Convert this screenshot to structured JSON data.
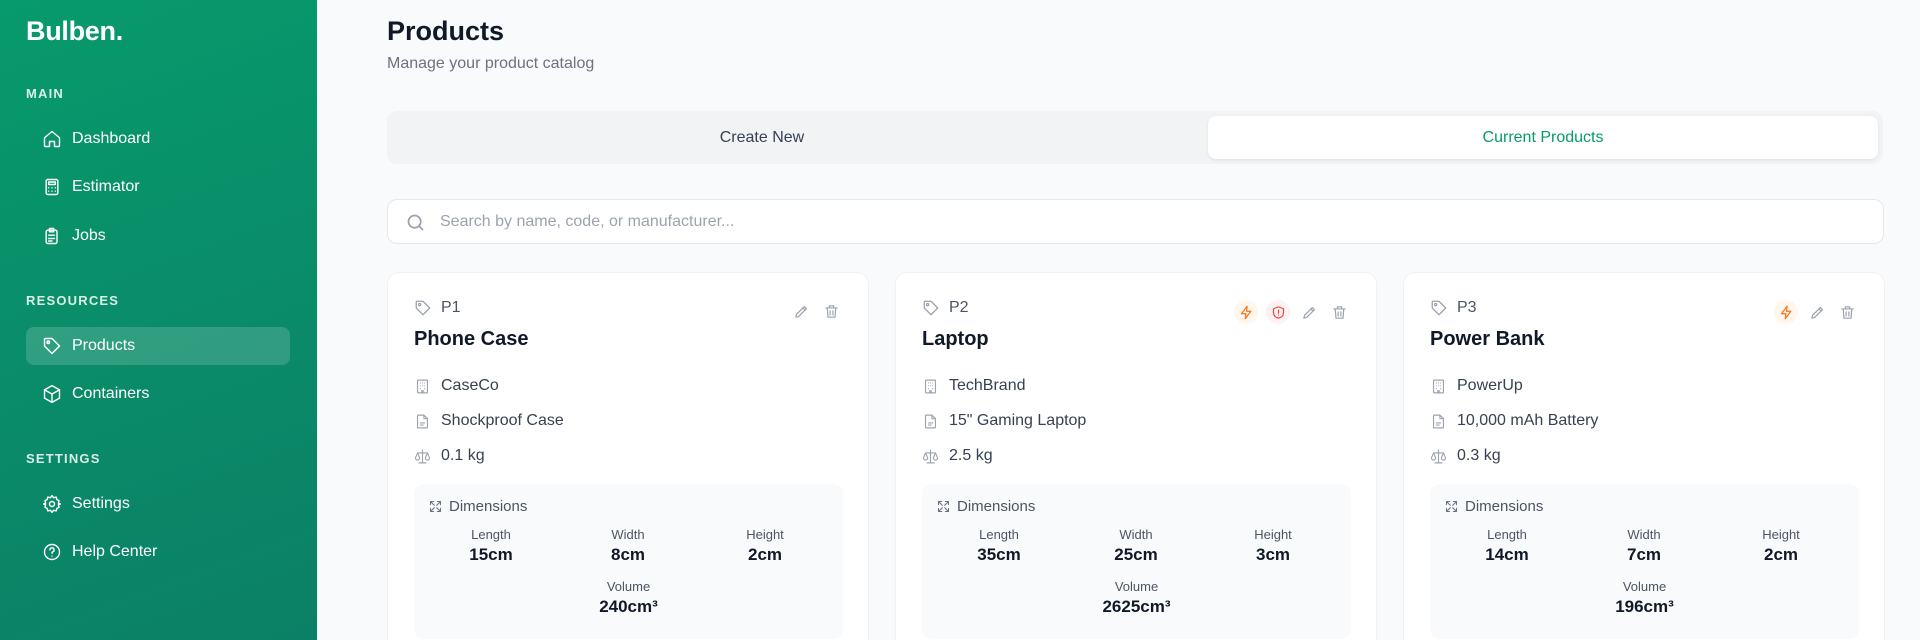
{
  "app": {
    "logo": "Bulben."
  },
  "sidebar": {
    "sections": [
      {
        "label": "MAIN"
      },
      {
        "label": "RESOURCES"
      },
      {
        "label": "SETTINGS"
      }
    ],
    "items": [
      {
        "label": "Dashboard",
        "icon": "home-icon",
        "active": false
      },
      {
        "label": "Estimator",
        "icon": "calculator-icon",
        "active": false
      },
      {
        "label": "Jobs",
        "icon": "clipboard-icon",
        "active": false
      },
      {
        "label": "Products",
        "icon": "tag-icon",
        "active": true
      },
      {
        "label": "Containers",
        "icon": "box-icon",
        "active": false
      },
      {
        "label": "Settings",
        "icon": "gear-icon",
        "active": false
      },
      {
        "label": "Help Center",
        "icon": "help-circle-icon",
        "active": false
      }
    ]
  },
  "header": {
    "title": "Products",
    "subtitle": "Manage your product catalog"
  },
  "tabs": [
    {
      "label": "Create New",
      "active": false
    },
    {
      "label": "Current Products",
      "active": true
    }
  ],
  "search": {
    "placeholder": "Search by name, code, or manufacturer...",
    "value": ""
  },
  "dimension_labels": {
    "title": "Dimensions",
    "length": "Length",
    "width": "Width",
    "height": "Height",
    "volume": "Volume"
  },
  "products": [
    {
      "code": "P1",
      "name": "Phone Case",
      "manufacturer": "CaseCo",
      "description": "Shockproof Case",
      "weight": "0.1 kg",
      "length": "15cm",
      "width": "8cm",
      "height": "2cm",
      "volume": "240cm³",
      "badges": []
    },
    {
      "code": "P2",
      "name": "Laptop",
      "manufacturer": "TechBrand",
      "description": "15\" Gaming Laptop",
      "weight": "2.5 kg",
      "length": "35cm",
      "width": "25cm",
      "height": "3cm",
      "volume": "2625cm³",
      "badges": [
        "bolt-icon",
        "shield-icon"
      ]
    },
    {
      "code": "P3",
      "name": "Power Bank",
      "manufacturer": "PowerUp",
      "description": "10,000 mAh Battery",
      "weight": "0.3 kg",
      "length": "14cm",
      "width": "7cm",
      "height": "2cm",
      "volume": "196cm³",
      "badges": [
        "bolt-icon"
      ]
    }
  ],
  "colors": {
    "brand": "#079a6c",
    "bolt": "#f97316",
    "shield": "#ef4444"
  }
}
